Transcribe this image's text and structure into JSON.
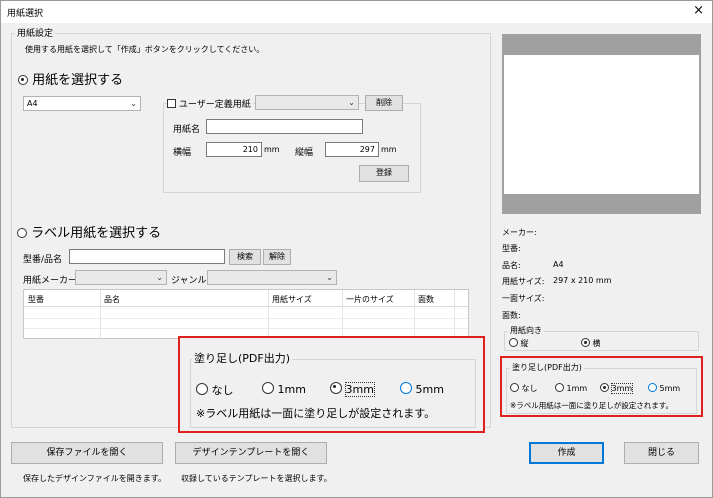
{
  "window": {
    "title": "用紙選択",
    "close_glyph": "×"
  },
  "paper_settings": {
    "group_label": "用紙設定",
    "instruction": "使用する用紙を選択して「作成」ボタンをクリックしてください。",
    "select_paper_radio": "用紙を選択する",
    "paper_size_value": "A4",
    "user_defined_label": "ユーザー定義用紙",
    "user_defined_select": "",
    "delete_button": "削除",
    "paper_name_label": "用紙名",
    "paper_name_value": "",
    "width_label": "横幅",
    "width_value": "210",
    "width_unit": "mm",
    "height_label": "縦幅",
    "height_value": "297",
    "height_unit": "mm",
    "register_button": "登録"
  },
  "label_paper": {
    "radio_label": "ラベル用紙を選択する",
    "model_label": "型番/品名",
    "model_value": "",
    "search_button": "検索",
    "clear_button": "解除",
    "maker_label": "用紙メーカー",
    "maker_value": "",
    "genre_label": "ジャンル",
    "genre_value": "",
    "columns": [
      "型番",
      "品名",
      "用紙サイズ",
      "一片のサイズ",
      "面数"
    ]
  },
  "preview": {
    "maker_label": "メーカー:",
    "maker_value": "",
    "model_label": "型番:",
    "model_value": "",
    "name_label": "品名:",
    "name_value": "A4",
    "size_label": "用紙サイズ:",
    "size_value": "297 x 210 mm",
    "piece_label": "一面サイズ:",
    "piece_value": "",
    "faces_label": "面数:",
    "faces_value": "",
    "orientation_group": "用紙向き",
    "portrait": "縦",
    "landscape": "横",
    "orientation_selected": "landscape"
  },
  "bleed": {
    "group_label": "塗り足し(PDF出力)",
    "options": [
      "なし",
      "1mm",
      "3mm",
      "5mm"
    ],
    "selected_index": 2,
    "note": "※ラベル用紙は一面に塗り足しが設定されます。"
  },
  "bottom": {
    "open_save_button": "保存ファイルを開く",
    "open_save_desc": "保存したデザインファイルを開きます。",
    "open_template_button": "デザインテンプレートを開く",
    "open_template_desc": "収録しているテンプレートを選択します。",
    "create_button": "作成",
    "close_button": "閉じる"
  },
  "colors": {
    "callout_border": "#e0201f",
    "accent": "#0078d7",
    "preview_bg": "#a0a0a0"
  }
}
